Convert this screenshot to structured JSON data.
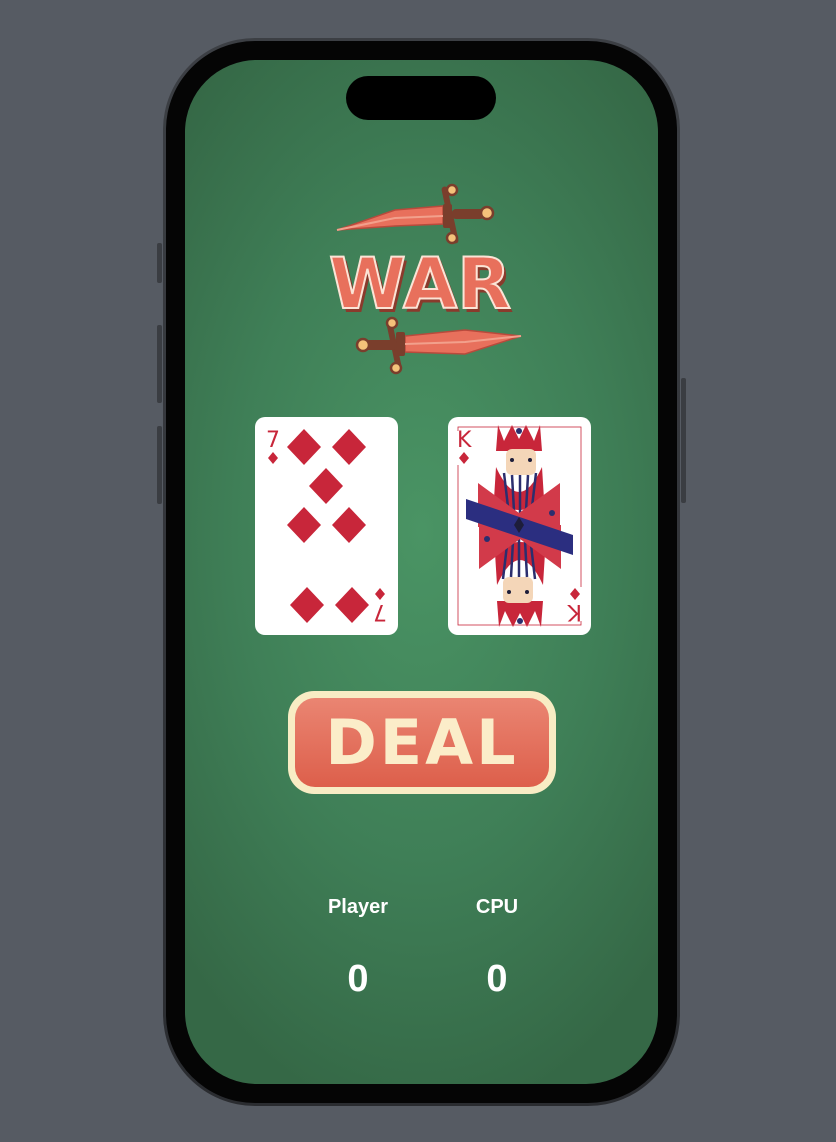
{
  "logo": {
    "text": "WAR"
  },
  "cards": {
    "player": {
      "rank": "7",
      "suit": "diamonds",
      "color": "#c8263a"
    },
    "cpu": {
      "rank": "K",
      "suit": "diamonds",
      "color": "#c8263a"
    }
  },
  "deal_button": {
    "label": "DEAL"
  },
  "scores": {
    "player": {
      "label": "Player",
      "value": "0"
    },
    "cpu": {
      "label": "CPU",
      "value": "0"
    }
  },
  "colors": {
    "table_green": "#4a9464",
    "button_red": "#dd5f4b",
    "button_cream": "#f8ecc4",
    "card_red": "#c8263a"
  }
}
